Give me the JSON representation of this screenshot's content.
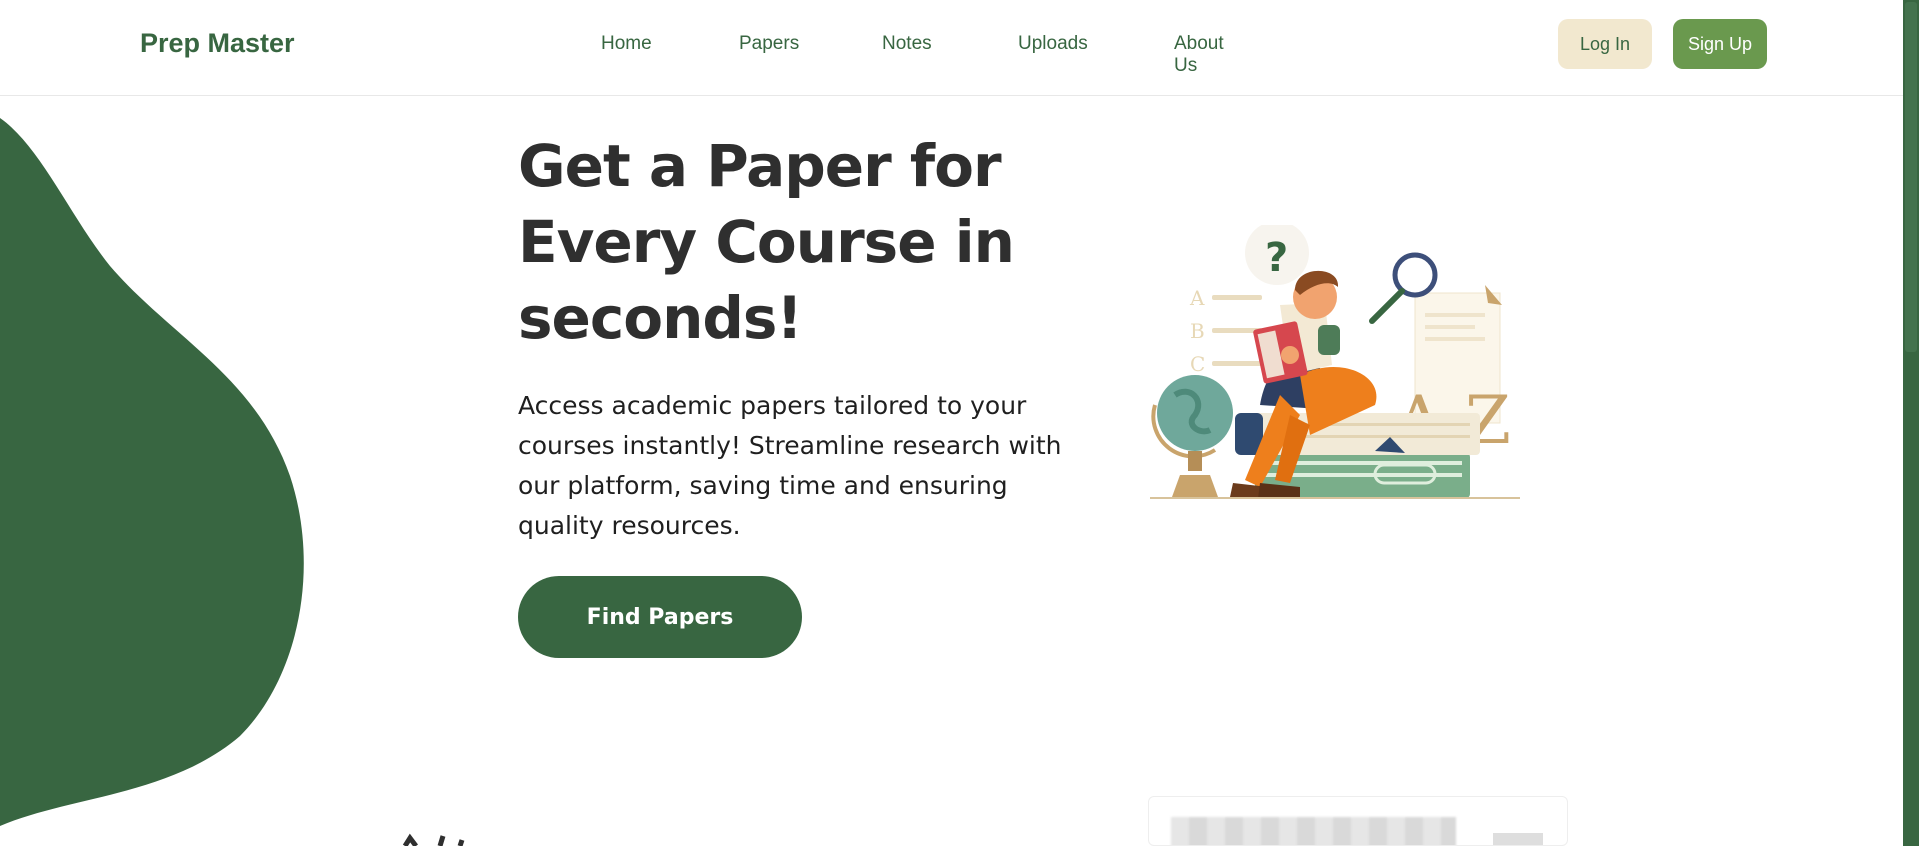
{
  "nav": {
    "brand": "Prep Master",
    "links": [
      "Home",
      "Papers",
      "Notes",
      "Uploads",
      "About Us"
    ],
    "login_label": "Log In",
    "signup_label": "Sign Up"
  },
  "hero": {
    "title": "Get a Paper for Every Course in seconds!",
    "description": "Access academic papers tailored to your courses instantly! Streamline research with our platform, saving time and ensuring quality resources.",
    "cta_label": "Find Papers"
  },
  "illustration": {
    "icon": "student-reading-books-illustration",
    "question_mark": "?",
    "letters": [
      "A",
      "B",
      "C"
    ],
    "az_label": "A-Z"
  },
  "colors": {
    "primary": "#386641",
    "secondary": "#6a994e",
    "cream": "#f2e8cf",
    "text": "#2f2f2f"
  }
}
